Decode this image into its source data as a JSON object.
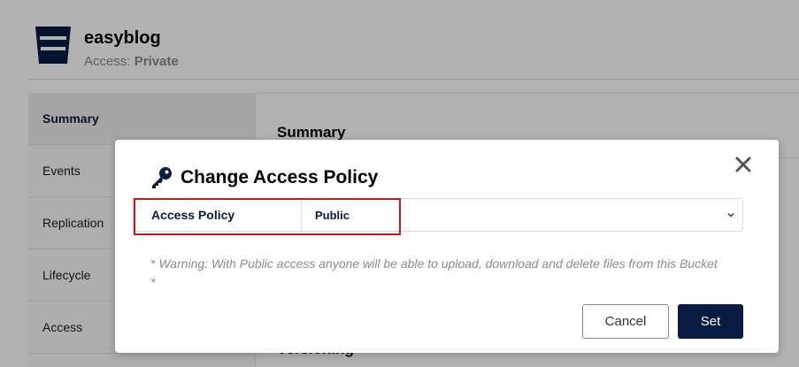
{
  "bucket": {
    "name": "easyblog",
    "access_label": "Access:",
    "access_value": "Private"
  },
  "sidebar": {
    "items": [
      {
        "label": "Summary",
        "active": true
      },
      {
        "label": "Events"
      },
      {
        "label": "Replication"
      },
      {
        "label": "Lifecycle"
      },
      {
        "label": "Access"
      }
    ]
  },
  "main": {
    "section_title": "Summary",
    "partial_section_title": "Versioning"
  },
  "modal": {
    "title": "Change Access Policy",
    "icon": "key-icon",
    "policy_label": "Access Policy",
    "policy_value": "Public",
    "warning": "* Warning: With Public access anyone will be able to upload, download and delete files from this Bucket *",
    "cancel_label": "Cancel",
    "set_label": "Set"
  },
  "colors": {
    "primary": "#081c42",
    "highlight": "#d4141c"
  }
}
